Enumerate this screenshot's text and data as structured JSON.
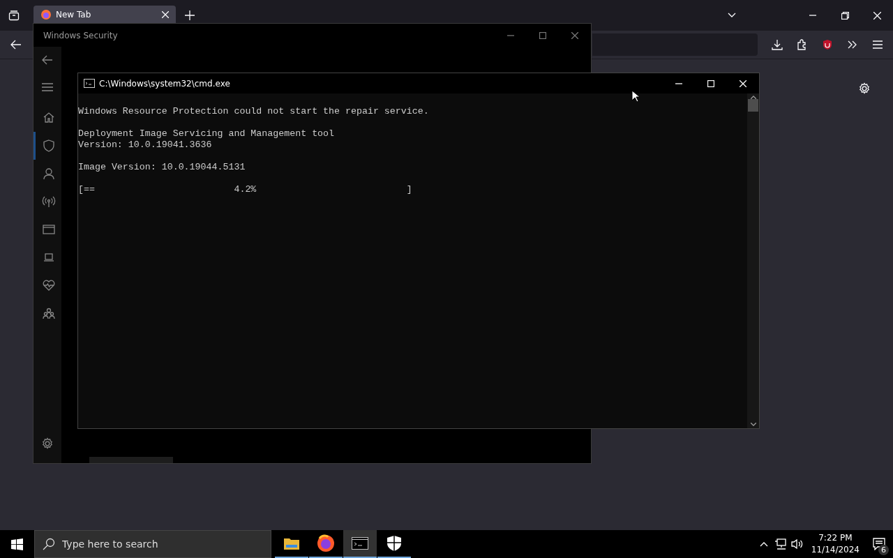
{
  "browser": {
    "tabs": [
      {
        "label": "New Tab",
        "selected": true
      }
    ]
  },
  "security_window": {
    "title": "Windows Security",
    "nav": [
      {
        "kind": "home",
        "selected": false
      },
      {
        "kind": "shield",
        "selected": true
      },
      {
        "kind": "person",
        "selected": false
      },
      {
        "kind": "wireless",
        "selected": false
      },
      {
        "kind": "browser",
        "selected": false
      },
      {
        "kind": "laptop",
        "selected": false
      },
      {
        "kind": "heart",
        "selected": false
      },
      {
        "kind": "family",
        "selected": false
      }
    ]
  },
  "cmd_window": {
    "title": "C:\\Windows\\system32\\cmd.exe",
    "blocks": [
      [
        "Windows Resource Protection could not start the repair service."
      ],
      [
        "Deployment Image Servicing and Management tool",
        "Version: 10.0.19041.3636"
      ],
      [
        "Image Version: 10.0.19044.5131"
      ],
      [
        "[==                         4.2%                           ]"
      ]
    ]
  },
  "taskbar": {
    "search": {
      "placeholder": "Type here to search"
    },
    "apps": [
      {
        "kind": "folder",
        "selected": false
      },
      {
        "kind": "browser",
        "selected": false
      },
      {
        "kind": "terminal",
        "selected": true
      },
      {
        "kind": "shield",
        "selected": false
      }
    ],
    "clock": {
      "time": "7:22 PM",
      "date": "11/14/2024"
    },
    "notifications": {
      "count": "6"
    }
  }
}
